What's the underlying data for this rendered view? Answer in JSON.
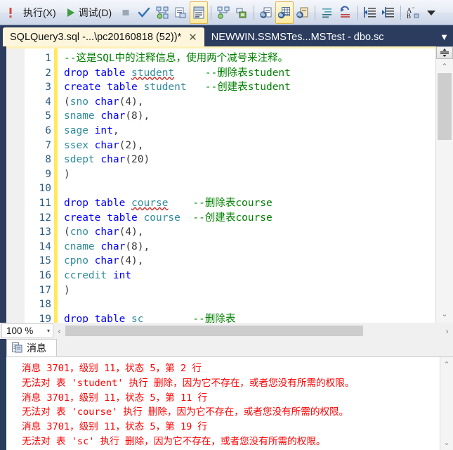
{
  "toolbar": {
    "run_label": "执行(X)",
    "debug_label": "调试(D)",
    "items": [
      {
        "name": "run-error-icon",
        "icon": "exclamation",
        "kind": "icon"
      },
      {
        "name": "execute-button",
        "icon": "run-text",
        "kind": "text",
        "label": "执行(X)"
      },
      {
        "name": "debug-button",
        "icon": "play-green",
        "kind": "text",
        "label": "调试(D)"
      },
      {
        "name": "stop-button",
        "icon": "stop-square",
        "kind": "icon"
      },
      {
        "name": "parse-check-button",
        "icon": "check-blue",
        "kind": "icon"
      },
      {
        "name": "display-estimated-plan-button",
        "icon": "plan-estimated",
        "kind": "icon"
      },
      {
        "name": "query-options-button",
        "icon": "query-options",
        "kind": "icon"
      },
      {
        "name": "results-to-text-button",
        "icon": "results-to-text",
        "kind": "icon",
        "checked": true
      },
      {
        "name": "include-actual-plan-button",
        "icon": "plan-actual",
        "kind": "icon"
      },
      {
        "name": "include-client-statistics-button",
        "icon": "client-stats",
        "kind": "icon"
      },
      {
        "name": "results-to-text2-button",
        "icon": "results-text-doc",
        "kind": "icon"
      },
      {
        "name": "results-to-grid-button",
        "icon": "results-grid",
        "kind": "icon",
        "checked": true
      },
      {
        "name": "results-to-file-button",
        "icon": "results-file",
        "kind": "icon"
      },
      {
        "name": "comment-lines-button",
        "icon": "comment-lines",
        "kind": "icon"
      },
      {
        "name": "uncomment-lines-button",
        "icon": "uncomment-lines",
        "kind": "icon"
      },
      {
        "name": "decrease-indent-button",
        "icon": "decrease-indent",
        "kind": "icon"
      },
      {
        "name": "increase-indent-button",
        "icon": "increase-indent",
        "kind": "icon"
      },
      {
        "name": "specify-values-button",
        "icon": "ab-sort",
        "kind": "icon"
      },
      {
        "name": "toolbar-overflow-button",
        "icon": "chevron-down",
        "kind": "icon"
      }
    ]
  },
  "tabs": {
    "items": [
      {
        "label": "SQLQuery3.sql -...\\pc20160818 (52))*",
        "active": true,
        "close": "✕"
      },
      {
        "label": "NEWWIN.SSMSTes...MSTest - dbo.sc",
        "active": false
      }
    ],
    "overflow_icon": "▼"
  },
  "editor": {
    "zoom": "100 %",
    "zoom_caret": "▾",
    "scroll_left_arrow": "‹",
    "scroll_right_arrow": "›",
    "up_arrow": "⌃",
    "down_arrow": "⌄",
    "split_icon": "⇳",
    "lines": [
      {
        "n": "1",
        "tokens": [
          {
            "t": "--这是SQL中的注释信息，使用两个减号来注释。",
            "c": "cmt"
          }
        ]
      },
      {
        "n": "2",
        "tokens": [
          {
            "t": "drop",
            "c": "kw"
          },
          {
            "t": " ",
            "c": "pun"
          },
          {
            "t": "table",
            "c": "kw"
          },
          {
            "t": " ",
            "c": "pun"
          },
          {
            "t": "student",
            "c": "id sq"
          },
          {
            "t": "     ",
            "c": "pun"
          },
          {
            "t": "--删除表student",
            "c": "cmt"
          }
        ]
      },
      {
        "n": "3",
        "tokens": [
          {
            "t": "create",
            "c": "kw"
          },
          {
            "t": " ",
            "c": "pun"
          },
          {
            "t": "table",
            "c": "kw"
          },
          {
            "t": " ",
            "c": "pun"
          },
          {
            "t": "student",
            "c": "id"
          },
          {
            "t": "   ",
            "c": "pun"
          },
          {
            "t": "--创建表student",
            "c": "cmt"
          }
        ]
      },
      {
        "n": "4",
        "tokens": [
          {
            "t": "(",
            "c": "pun"
          },
          {
            "t": "sno",
            "c": "id"
          },
          {
            "t": " ",
            "c": "pun"
          },
          {
            "t": "char",
            "c": "typ"
          },
          {
            "t": "(",
            "c": "pun"
          },
          {
            "t": "4",
            "c": "num"
          },
          {
            "t": "),",
            "c": "pun"
          }
        ]
      },
      {
        "n": "5",
        "tokens": [
          {
            "t": "sname",
            "c": "id"
          },
          {
            "t": " ",
            "c": "pun"
          },
          {
            "t": "char",
            "c": "typ"
          },
          {
            "t": "(",
            "c": "pun"
          },
          {
            "t": "8",
            "c": "num"
          },
          {
            "t": "),",
            "c": "pun"
          }
        ]
      },
      {
        "n": "6",
        "tokens": [
          {
            "t": "sage",
            "c": "id"
          },
          {
            "t": " ",
            "c": "pun"
          },
          {
            "t": "int",
            "c": "typ"
          },
          {
            "t": ",",
            "c": "pun"
          }
        ]
      },
      {
        "n": "7",
        "tokens": [
          {
            "t": "ssex",
            "c": "id"
          },
          {
            "t": " ",
            "c": "pun"
          },
          {
            "t": "char",
            "c": "typ"
          },
          {
            "t": "(",
            "c": "pun"
          },
          {
            "t": "2",
            "c": "num"
          },
          {
            "t": "),",
            "c": "pun"
          }
        ]
      },
      {
        "n": "8",
        "tokens": [
          {
            "t": "sdept",
            "c": "id"
          },
          {
            "t": " ",
            "c": "pun"
          },
          {
            "t": "char",
            "c": "typ"
          },
          {
            "t": "(",
            "c": "pun"
          },
          {
            "t": "20",
            "c": "num"
          },
          {
            "t": ")",
            "c": "pun"
          }
        ]
      },
      {
        "n": "9",
        "tokens": [
          {
            "t": ")",
            "c": "pun"
          }
        ]
      },
      {
        "n": "10",
        "tokens": []
      },
      {
        "n": "11",
        "tokens": [
          {
            "t": "drop",
            "c": "kw"
          },
          {
            "t": " ",
            "c": "pun"
          },
          {
            "t": "table",
            "c": "kw"
          },
          {
            "t": " ",
            "c": "pun"
          },
          {
            "t": "course",
            "c": "id sq"
          },
          {
            "t": "    ",
            "c": "pun"
          },
          {
            "t": "--删除表course",
            "c": "cmt"
          }
        ]
      },
      {
        "n": "12",
        "tokens": [
          {
            "t": "create",
            "c": "kw"
          },
          {
            "t": " ",
            "c": "pun"
          },
          {
            "t": "table",
            "c": "kw"
          },
          {
            "t": " ",
            "c": "pun"
          },
          {
            "t": "course",
            "c": "id"
          },
          {
            "t": "  ",
            "c": "pun"
          },
          {
            "t": "--创建表course",
            "c": "cmt"
          }
        ]
      },
      {
        "n": "13",
        "tokens": [
          {
            "t": "(",
            "c": "pun"
          },
          {
            "t": "cno",
            "c": "id"
          },
          {
            "t": " ",
            "c": "pun"
          },
          {
            "t": "char",
            "c": "typ"
          },
          {
            "t": "(",
            "c": "pun"
          },
          {
            "t": "4",
            "c": "num"
          },
          {
            "t": "),",
            "c": "pun"
          }
        ]
      },
      {
        "n": "14",
        "tokens": [
          {
            "t": "cname",
            "c": "id"
          },
          {
            "t": " ",
            "c": "pun"
          },
          {
            "t": "char",
            "c": "typ"
          },
          {
            "t": "(",
            "c": "pun"
          },
          {
            "t": "8",
            "c": "num"
          },
          {
            "t": "),",
            "c": "pun"
          }
        ]
      },
      {
        "n": "15",
        "tokens": [
          {
            "t": "cpno",
            "c": "id"
          },
          {
            "t": " ",
            "c": "pun"
          },
          {
            "t": "char",
            "c": "typ"
          },
          {
            "t": "(",
            "c": "pun"
          },
          {
            "t": "4",
            "c": "num"
          },
          {
            "t": "),",
            "c": "pun"
          }
        ]
      },
      {
        "n": "16",
        "tokens": [
          {
            "t": "ccredit",
            "c": "id"
          },
          {
            "t": " ",
            "c": "pun"
          },
          {
            "t": "int",
            "c": "typ"
          }
        ]
      },
      {
        "n": "17",
        "tokens": [
          {
            "t": ")",
            "c": "pun"
          }
        ]
      },
      {
        "n": "18",
        "tokens": []
      },
      {
        "n": "19",
        "tokens": [
          {
            "t": "drop",
            "c": "kw"
          },
          {
            "t": " ",
            "c": "pun"
          },
          {
            "t": "table",
            "c": "kw"
          },
          {
            "t": " ",
            "c": "pun"
          },
          {
            "t": "sc",
            "c": "id sq"
          },
          {
            "t": "        ",
            "c": "pun"
          },
          {
            "t": "--删除表",
            "c": "cmt"
          }
        ]
      }
    ]
  },
  "messages": {
    "tab_label": "消息",
    "tab_icon": "messages-icon",
    "up_arrow": "⌃",
    "down_arrow": "⌄",
    "lines": [
      "消息 3701，级别 11，状态 5，第 2 行",
      "无法对 表 'student' 执行 删除，因为它不存在，或者您没有所需的权限。",
      "消息 3701，级别 11，状态 5，第 11 行",
      "无法对 表 'course' 执行 删除，因为它不存在，或者您没有所需的权限。",
      "消息 3701，级别 11，状态 5，第 19 行",
      "无法对 表 'sc' 执行 删除，因为它不存在，或者您没有所需的权限。"
    ]
  },
  "colors": {
    "chrome": "#2b3c5e",
    "active_tab": "#fdf6dd",
    "error_text": "#ff0000",
    "keyword": "#0000ff",
    "comment": "#008000",
    "identifier": "#2e8b9b",
    "change_bar": "#ffe95c"
  }
}
